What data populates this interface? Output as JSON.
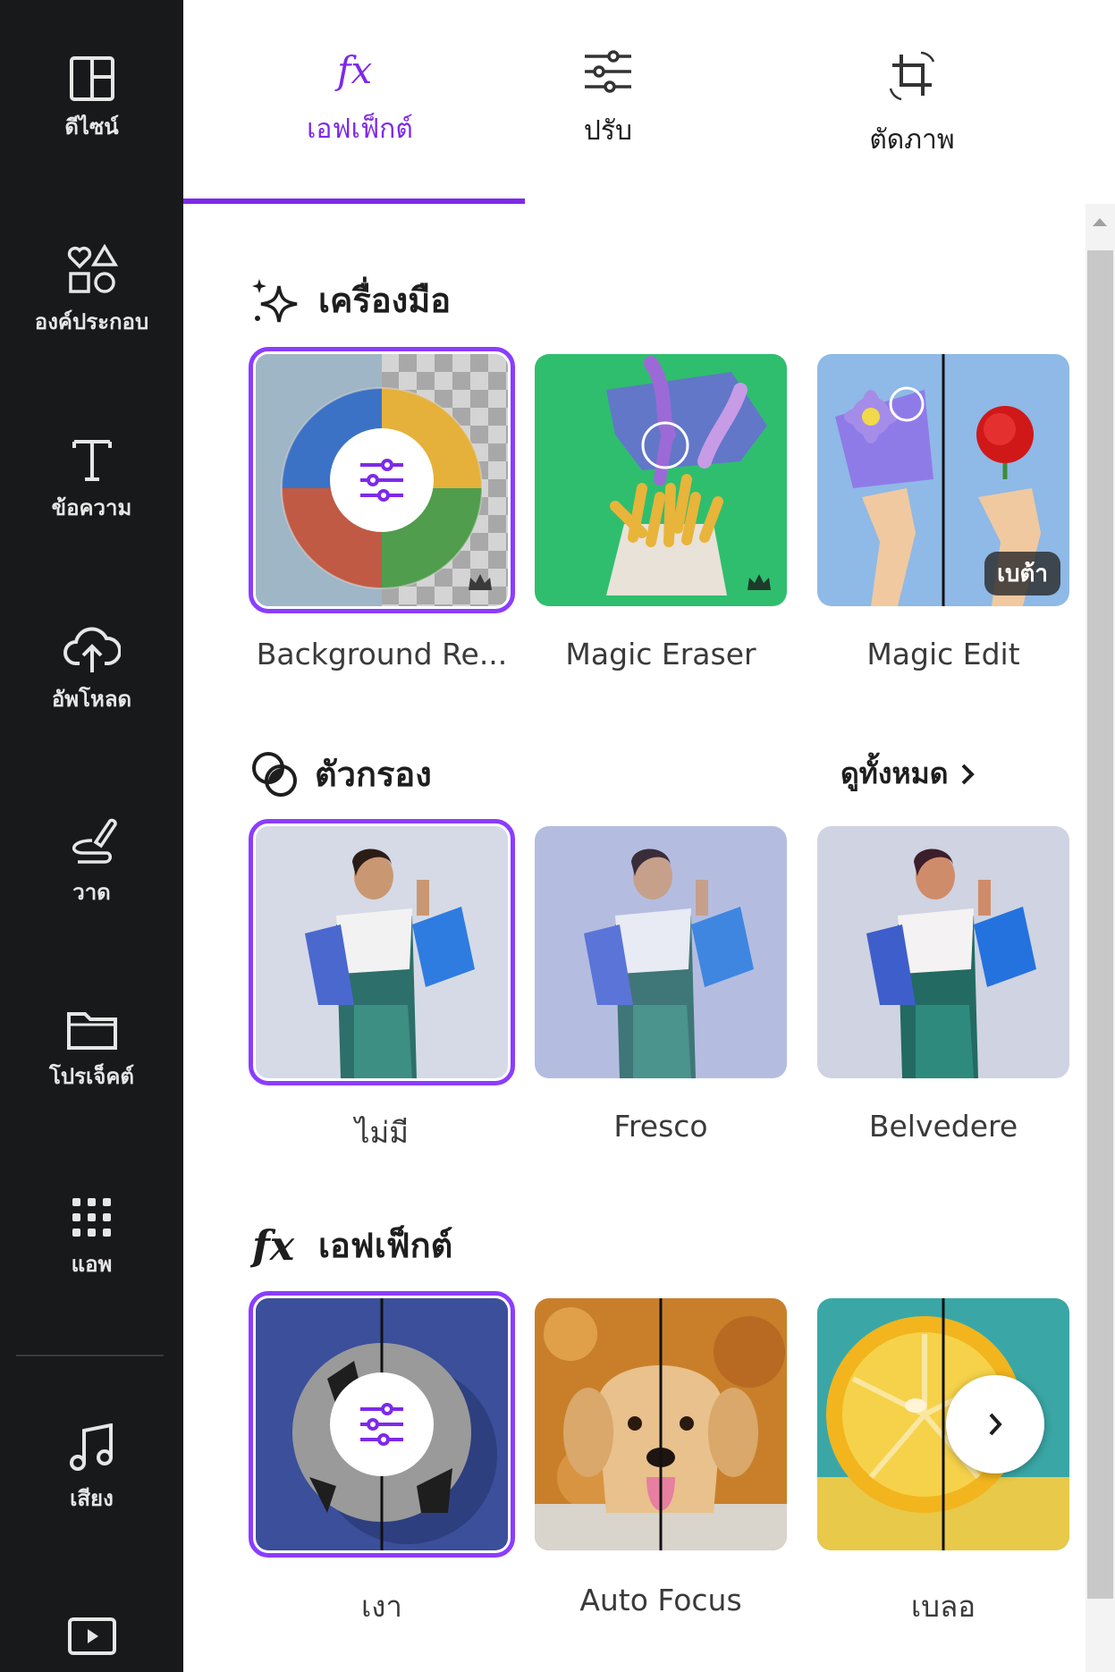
{
  "sidebar": {
    "items": [
      {
        "label": "ดีไซน์",
        "icon": "layout-icon"
      },
      {
        "label": "องค์ประกอบ",
        "icon": "shapes-icon"
      },
      {
        "label": "ข้อความ",
        "icon": "text-icon"
      },
      {
        "label": "อัพโหลด",
        "icon": "cloud-upload-icon"
      },
      {
        "label": "วาด",
        "icon": "draw-icon"
      },
      {
        "label": "โปรเจ็คต์",
        "icon": "folder-icon"
      },
      {
        "label": "แอพ",
        "icon": "apps-grid-icon"
      },
      {
        "label": "เสียง",
        "icon": "music-note-icon"
      },
      {
        "label": "",
        "icon": "video-icon"
      }
    ]
  },
  "tabs": [
    {
      "label": "เอฟเฟ็กต์",
      "icon": "fx-icon",
      "active": true
    },
    {
      "label": "ปรับ",
      "icon": "sliders-icon",
      "active": false
    },
    {
      "label": "ตัดภาพ",
      "icon": "crop-icon",
      "active": false
    }
  ],
  "sections": {
    "tools": {
      "title": "เครื่องมือ",
      "icon": "sparkle-icon",
      "items": [
        {
          "label": "Background Re...",
          "badge": "crown-icon"
        },
        {
          "label": "Magic Eraser",
          "badge": "crown-icon"
        },
        {
          "label": "Magic Edit",
          "badge": "เบต้า"
        }
      ]
    },
    "filters": {
      "title": "ตัวกรอง",
      "icon": "filter-circles-icon",
      "see_all": "ดูทั้งหมด",
      "items": [
        {
          "label": "ไม่มี"
        },
        {
          "label": "Fresco"
        },
        {
          "label": "Belvedere"
        }
      ]
    },
    "effects": {
      "title": "เอฟเฟ็กต์",
      "icon": "fx-icon",
      "items": [
        {
          "label": "เงา"
        },
        {
          "label": "Auto Focus"
        },
        {
          "label": "เบลอ"
        }
      ]
    }
  },
  "colors": {
    "accent": "#7d2ae8",
    "sidebar_bg": "#18191b",
    "selection_outline": "#8b3dff"
  }
}
